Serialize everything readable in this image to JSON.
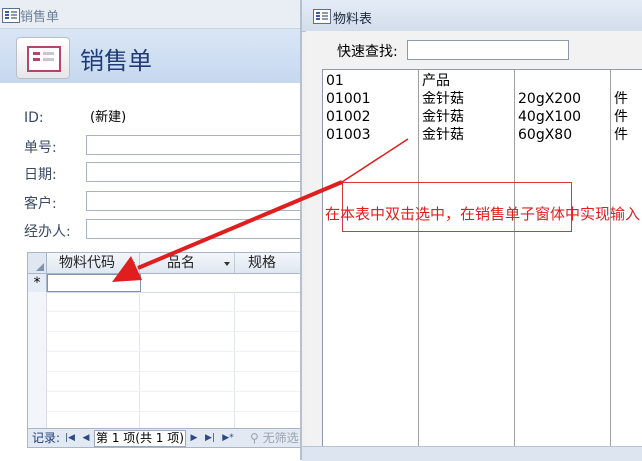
{
  "sales_form": {
    "window_title": "销售单",
    "heading": "销售单",
    "fields": [
      {
        "label": "ID:",
        "value": "(新建)"
      },
      {
        "label": "单号:",
        "value": ""
      },
      {
        "label": "日期:",
        "value": ""
      },
      {
        "label": "客户:",
        "value": ""
      },
      {
        "label": "经办人:",
        "value": ""
      }
    ],
    "subform": {
      "columns": [
        "物料代码",
        "品名",
        "规格"
      ],
      "new_row_marker": "*"
    },
    "nav": {
      "label": "记录:",
      "position": "第 1 项(共 1 项)",
      "filter": "无筛选"
    }
  },
  "material_window": {
    "title": "物料表",
    "search_label": "快速查找:",
    "search_value": "",
    "rows": [
      [
        "01",
        "产品",
        "",
        ""
      ],
      [
        "01001",
        "金针菇",
        "20gX200",
        "件"
      ],
      [
        "01002",
        "金针菇",
        "40gX100",
        "件"
      ],
      [
        "01003",
        "金针菇",
        "60gX80",
        "件"
      ]
    ]
  },
  "annotation": {
    "text": "在本表中双击选中，在销售单子窗体中实现输入",
    "color": "#e11e1e"
  },
  "colors": {
    "header_band": "#c6d8ef",
    "heading_text": "#1f3b78",
    "annotation_red": "#e11e1e"
  }
}
